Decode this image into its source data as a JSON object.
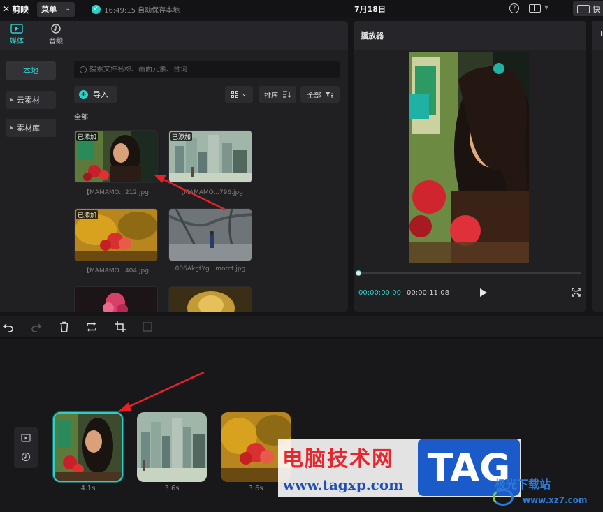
{
  "topbar": {
    "logo_text": "剪映",
    "menu_label": "菜单",
    "save_status": "16:49:15 自动保存本地",
    "project_title": "7月18日",
    "help_icon": "question-circle-icon",
    "layout_icon": "layout-icon",
    "shortcut_label": "快"
  },
  "media": {
    "tabs": [
      {
        "label": "媒体",
        "icon": "media-icon",
        "active": true
      },
      {
        "label": "音频",
        "icon": "audio-icon",
        "active": false
      }
    ],
    "nav": [
      {
        "label": "本地",
        "active": true
      },
      {
        "label": "云素材",
        "active": false
      },
      {
        "label": "素材库",
        "active": false
      }
    ],
    "search_placeholder": "搜索文件名称、画面元素、台词",
    "import_label": "导入",
    "sort_label": "排序",
    "filter_label": "全部",
    "section_label": "全部",
    "added_badge": "已添加",
    "items": [
      {
        "name": "【MAMAMO...212.jpg",
        "added": true
      },
      {
        "name": "【MAMAMO...796.jpg",
        "added": true
      },
      {
        "name": "【MAMAMO...404.jpg",
        "added": true
      },
      {
        "name": "006AkgtYg...motct.jpg",
        "added": false
      },
      {
        "name": "",
        "added": false
      },
      {
        "name": "",
        "added": false
      }
    ]
  },
  "player": {
    "title": "播放器",
    "current_time": "00:00:00:00",
    "total_time": "00:00:11:08",
    "progress": 0
  },
  "right_panel": {
    "title": "In"
  },
  "timeline": {
    "clips": [
      {
        "duration": "4.1s",
        "selected": true
      },
      {
        "duration": "3.6s",
        "selected": false
      },
      {
        "duration": "3.6s",
        "selected": false
      }
    ]
  },
  "watermarks": {
    "site_name": "电脑技术网",
    "site_url": "www.tagxp.com",
    "tag": "TAG",
    "site2_name": "极光下载站",
    "site2_url": "www.xz7.com"
  },
  "colors": {
    "accent": "#2ad1c9",
    "panel": "#202023",
    "background": "#151517"
  }
}
